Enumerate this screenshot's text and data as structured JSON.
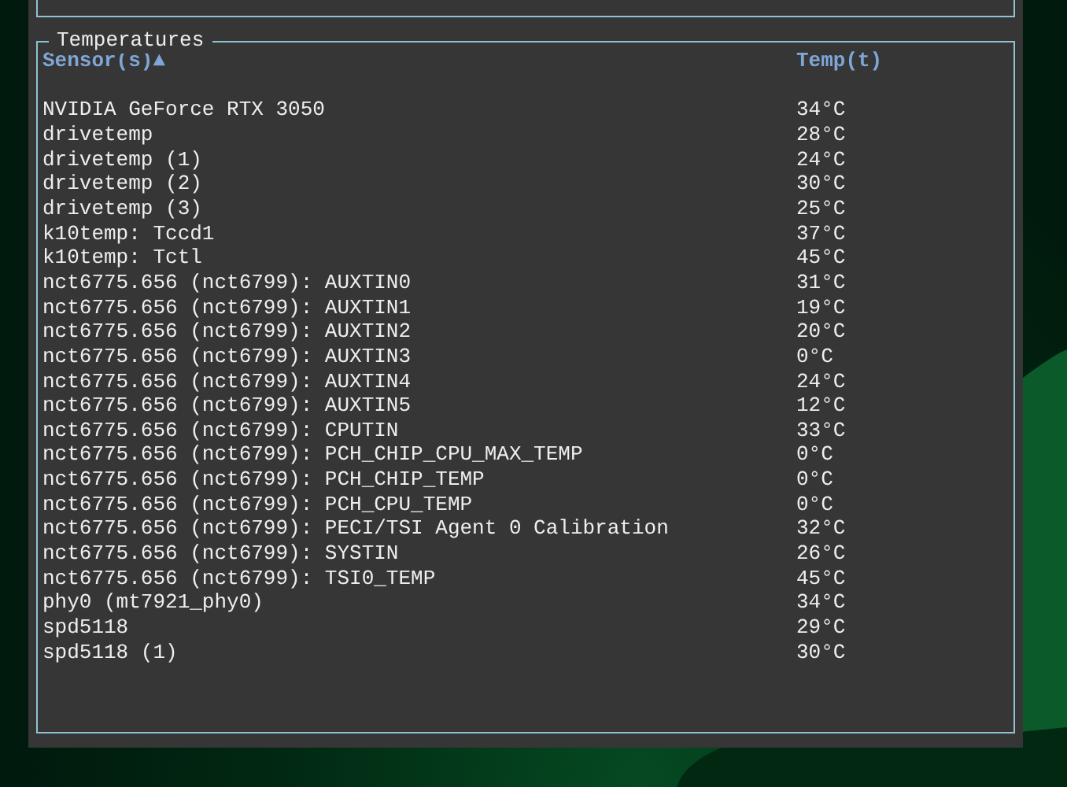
{
  "panel": {
    "title": "Temperatures"
  },
  "table": {
    "columns": [
      {
        "label": "Sensor(s)▲",
        "kind": "sensor"
      },
      {
        "label": "Temp(t)",
        "kind": "temp"
      }
    ],
    "rows": [
      {
        "sensor": "NVIDIA GeForce RTX 3050",
        "temp": "34°C"
      },
      {
        "sensor": "drivetemp",
        "temp": "28°C"
      },
      {
        "sensor": "drivetemp (1)",
        "temp": "24°C"
      },
      {
        "sensor": "drivetemp (2)",
        "temp": "30°C"
      },
      {
        "sensor": "drivetemp (3)",
        "temp": "25°C"
      },
      {
        "sensor": "k10temp: Tccd1",
        "temp": "37°C"
      },
      {
        "sensor": "k10temp: Tctl",
        "temp": "45°C"
      },
      {
        "sensor": "nct6775.656 (nct6799): AUXTIN0",
        "temp": "31°C"
      },
      {
        "sensor": "nct6775.656 (nct6799): AUXTIN1",
        "temp": "19°C"
      },
      {
        "sensor": "nct6775.656 (nct6799): AUXTIN2",
        "temp": "20°C"
      },
      {
        "sensor": "nct6775.656 (nct6799): AUXTIN3",
        "temp": "0°C"
      },
      {
        "sensor": "nct6775.656 (nct6799): AUXTIN4",
        "temp": "24°C"
      },
      {
        "sensor": "nct6775.656 (nct6799): AUXTIN5",
        "temp": "12°C"
      },
      {
        "sensor": "nct6775.656 (nct6799): CPUTIN",
        "temp": "33°C"
      },
      {
        "sensor": "nct6775.656 (nct6799): PCH_CHIP_CPU_MAX_TEMP",
        "temp": "0°C"
      },
      {
        "sensor": "nct6775.656 (nct6799): PCH_CHIP_TEMP",
        "temp": "0°C"
      },
      {
        "sensor": "nct6775.656 (nct6799): PCH_CPU_TEMP",
        "temp": "0°C"
      },
      {
        "sensor": "nct6775.656 (nct6799): PECI/TSI Agent 0 Calibration",
        "temp": "32°C"
      },
      {
        "sensor": "nct6775.656 (nct6799): SYSTIN",
        "temp": "26°C"
      },
      {
        "sensor": "nct6775.656 (nct6799): TSI0_TEMP",
        "temp": "45°C"
      },
      {
        "sensor": "phy0 (mt7921_phy0)",
        "temp": "34°C"
      },
      {
        "sensor": "spd5118",
        "temp": "29°C"
      },
      {
        "sensor": "spd5118 (1)",
        "temp": "30°C"
      }
    ]
  }
}
